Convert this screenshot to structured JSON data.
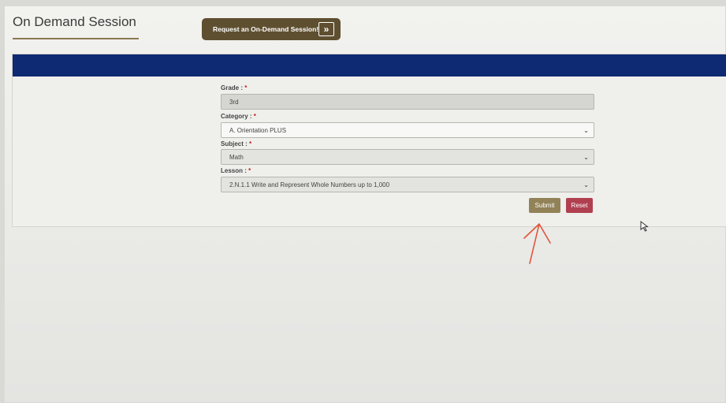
{
  "page": {
    "title": "On Demand Session",
    "request_button_label": "Request an On-Demand Session!",
    "request_button_icon": "double-chevron-right-icon"
  },
  "form": {
    "grade": {
      "label": "Grade :",
      "required_mark": "*",
      "value": "3rd"
    },
    "category": {
      "label": "Category :",
      "required_mark": "*",
      "value": "A. Orientation PLUS"
    },
    "subject": {
      "label": "Subject :",
      "required_mark": "*",
      "value": "Math"
    },
    "lesson": {
      "label": "Lesson :",
      "required_mark": "*",
      "value": "2.N.1.1 Write and Represent Whole Numbers up to 1,000"
    },
    "submit_label": "Submit",
    "reset_label": "Reset"
  },
  "colors": {
    "header_bar": "#0d2a72",
    "submit": "#928258",
    "reset": "#b04050",
    "request_button": "#5e4f30",
    "annotation_arrow": "#e0553a"
  }
}
